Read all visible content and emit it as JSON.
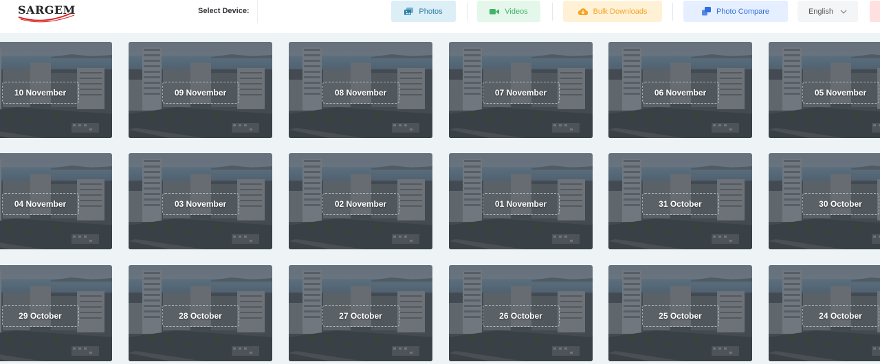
{
  "header": {
    "logo": "SARGEM",
    "select_device_label": "Select Device:",
    "nav": {
      "photos": "Photos",
      "videos": "Videos",
      "bulk_downloads": "Bulk Downloads",
      "photo_compare": "Photo Compare"
    },
    "language": "English"
  },
  "gallery": {
    "rows": [
      [
        "10 November",
        "09 November",
        "08 November",
        "07 November",
        "06 November",
        "05 November"
      ],
      [
        "04 November",
        "03 November",
        "02 November",
        "01 November",
        "31 October",
        "30 October"
      ],
      [
        "29 October",
        "28 October",
        "27 October",
        "26 October",
        "25 October",
        "24 October"
      ]
    ]
  },
  "colors": {
    "photos": "#2a7da6",
    "videos": "#42b469",
    "bulk_downloads": "#f4a422",
    "photo_compare": "#2f6fe0"
  }
}
